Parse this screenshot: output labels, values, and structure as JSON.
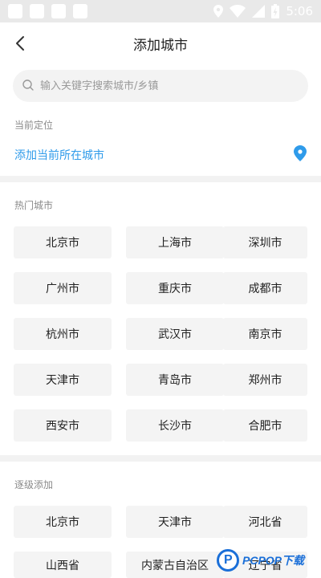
{
  "status_bar": {
    "time": "5:06"
  },
  "header": {
    "title": "添加城市"
  },
  "search": {
    "placeholder": "输入关键字搜索城市/乡镇"
  },
  "current_location": {
    "section_label": "当前定位",
    "action_label": "添加当前所在城市"
  },
  "hot_cities": {
    "section_label": "热门城市",
    "items": [
      "北京市",
      "上海市",
      "深圳市",
      "广州市",
      "重庆市",
      "成都市",
      "杭州市",
      "武汉市",
      "南京市",
      "天津市",
      "青岛市",
      "郑州市",
      "西安市",
      "长沙市",
      "合肥市"
    ]
  },
  "step_add": {
    "section_label": "逐级添加",
    "items": [
      "北京市",
      "天津市",
      "河北省",
      "山西省",
      "内蒙古自治区",
      "辽宁省"
    ]
  },
  "watermark": {
    "logo": "P",
    "text": "PCPOP下载"
  },
  "colors": {
    "accent": "#2f9bea",
    "button_bg": "#f4f4f4",
    "divider": "#f2f2f2"
  }
}
